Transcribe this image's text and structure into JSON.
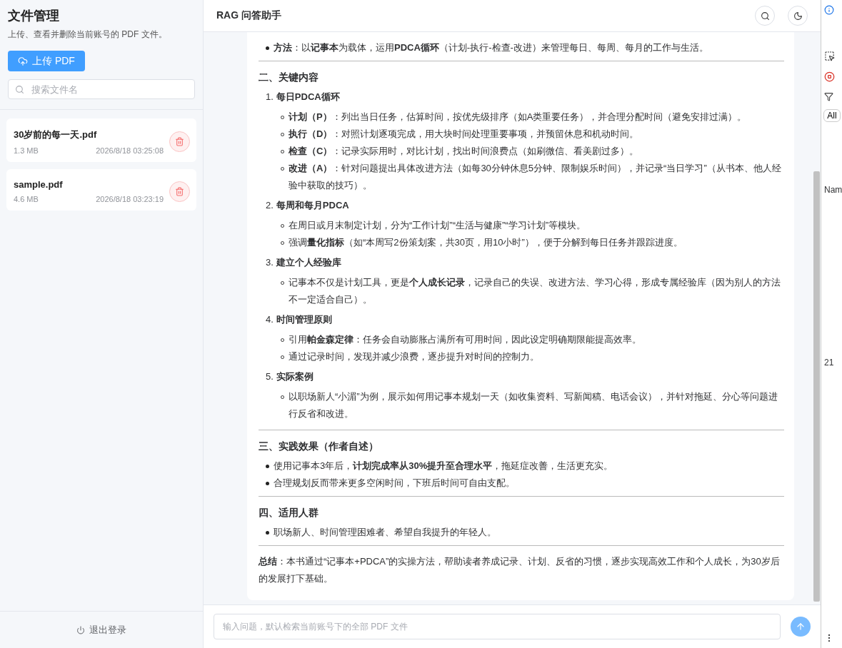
{
  "sidebar": {
    "title": "文件管理",
    "subtitle": "上传、查看并删除当前账号的 PDF 文件。",
    "upload_button": "上传 PDF",
    "search": {
      "placeholder": "搜索文件名"
    },
    "files": [
      {
        "name": "30岁前的每一天.pdf",
        "size": "1.3 MB",
        "time": "2026/8/18 03:25:08"
      },
      {
        "name": "sample.pdf",
        "size": "4.6 MB",
        "time": "2026/8/18 03:23:19"
      }
    ],
    "logout": "退出登录"
  },
  "header": {
    "title": "RAG 问答助手"
  },
  "answer": {
    "blocks": [
      {
        "kind": "bullet",
        "text": "**方法**：以**记事本**为载体，运用**PDCA循环**（计划-执行-检查-改进）来管理每日、每周、每月的工作与生活。"
      },
      {
        "kind": "rule"
      },
      {
        "kind": "heading",
        "text": "二、关键内容"
      },
      {
        "kind": "numbered",
        "number": "1.",
        "text": "每日PDCA循环",
        "children": [
          "**计划（P）**：列出当日任务，估算时间，按优先级排序（如A类重要任务），并合理分配时间（避免安排过满）。",
          "**执行（D）**：对照计划逐项完成，用大块时间处理重要事项，并预留休息和机动时间。",
          "**检查（C）**：记录实际用时，对比计划，找出时间浪费点（如刷微信、看美剧过多）。",
          "**改进（A）**：针对问题提出具体改进方法（如每30分钟休息5分钟、限制娱乐时间），并记录“当日学习”（从书本、他人经验中获取的技巧）。"
        ]
      },
      {
        "kind": "numbered",
        "number": "2.",
        "text": "每周和每月PDCA",
        "children": [
          "在周日或月末制定计划，分为“工作计划”“生活与健康”“学习计划”等模块。",
          "强调**量化指标**（如“本周写2份策划案，共30页，用10小时”），便于分解到每日任务并跟踪进度。"
        ]
      },
      {
        "kind": "numbered",
        "number": "3.",
        "text": "建立个人经验库",
        "children": [
          "记事本不仅是计划工具，更是**个人成长记录**，记录自己的失误、改进方法、学习心得，形成专属经验库（因为别人的方法不一定适合自己）。"
        ]
      },
      {
        "kind": "numbered",
        "number": "4.",
        "text": "时间管理原则",
        "children": [
          "引用**帕金森定律**：任务会自动膨胀占满所有可用时间，因此设定明确期限能提高效率。",
          "通过记录时间，发现并减少浪费，逐步提升对时间的控制力。"
        ]
      },
      {
        "kind": "numbered",
        "number": "5.",
        "text": "实际案例",
        "children": [
          "以职场新人“小湄”为例，展示如何用记事本规划一天（如收集资料、写新闻稿、电话会议），并针对拖延、分心等问题进行反省和改进。"
        ]
      },
      {
        "kind": "rule"
      },
      {
        "kind": "heading",
        "text": "三、实践效果（作者自述）"
      },
      {
        "kind": "bullet",
        "text": "使用记事本3年后，**计划完成率从30%提升至合理水平**，拖延症改善，生活更充实。"
      },
      {
        "kind": "bullet",
        "text": "合理规划反而带来更多空闲时间，下班后时间可自由支配。"
      },
      {
        "kind": "rule"
      },
      {
        "kind": "heading",
        "text": "四、适用人群"
      },
      {
        "kind": "bullet",
        "text": "职场新人、时间管理困难者、希望自我提升的年轻人。"
      },
      {
        "kind": "rule"
      },
      {
        "kind": "paragraph",
        "text": "**总结**：本书通过“记事本+PDCA”的实操方法，帮助读者养成记录、计划、反省的习惯，逐步实现高效工作和个人成长，为30岁后的发展打下基础。"
      }
    ]
  },
  "input": {
    "placeholder": "输入问题，默认检索当前账号下的全部 PDF 文件"
  },
  "devtools": {
    "filter_button": "All",
    "column_header": "Nam",
    "row_value": "21"
  }
}
